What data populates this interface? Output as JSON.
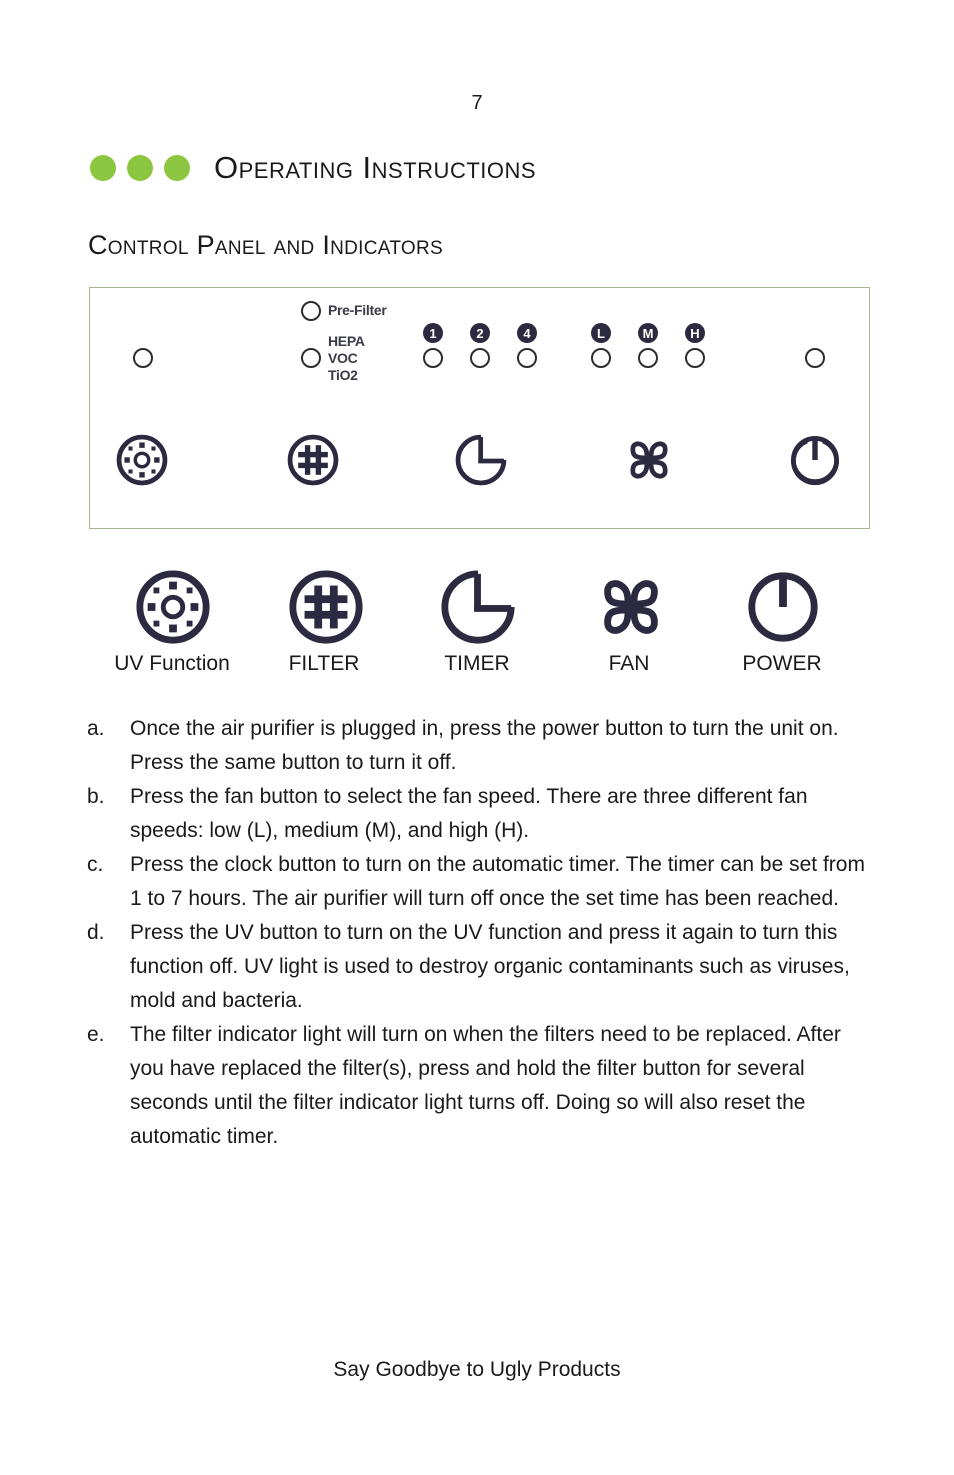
{
  "page_number": "7",
  "heading": "Operating Instructions",
  "subheading": "Control Panel and Indicators",
  "colors": {
    "accent_green": "#8cc540",
    "panel_border": "#a3b58d",
    "icon_dark": "#2c2a40"
  },
  "panel": {
    "filter_labels": {
      "pre_filter": "Pre-Filter",
      "hepa": "HEPA",
      "voc": "VOC",
      "tio2": "TiO2"
    },
    "timer_badges": [
      "1",
      "2",
      "4"
    ],
    "fan_badges": [
      "L",
      "M",
      "H"
    ],
    "icons": [
      "uv-icon",
      "filter-icon",
      "timer-icon",
      "fan-icon",
      "power-icon"
    ]
  },
  "buttons": [
    {
      "icon": "uv-icon",
      "label": "UV Function"
    },
    {
      "icon": "filter-icon",
      "label": "FILTER"
    },
    {
      "icon": "timer-icon",
      "label": "TIMER"
    },
    {
      "icon": "fan-icon",
      "label": "FAN"
    },
    {
      "icon": "power-icon",
      "label": "POWER"
    }
  ],
  "instructions": [
    {
      "marker": "a.",
      "text": "Once the air purifier is plugged in, press the power button to turn the unit on. Press the same button to turn it off."
    },
    {
      "marker": "b.",
      "text": "Press the fan button to select the fan speed. There are three different fan speeds: low (L), medium (M), and high (H)."
    },
    {
      "marker": "c.",
      "text": "Press the clock button to turn on the automatic timer. The timer can be set from 1 to 7 hours. The air purifier will turn off once the set time has been reached."
    },
    {
      "marker": "d.",
      "text": "Press the UV button to turn on the UV function and press it again to turn this function off. UV light is used to destroy organic contaminants such as viruses, mold and bacteria."
    },
    {
      "marker": "e.",
      "text": "The filter indicator light will turn on when the filters need to be replaced. After you have replaced the filter(s), press and hold the filter button for several seconds until the filter indicator light turns off. Doing so will also reset the automatic timer."
    }
  ],
  "footer": "Say Goodbye to Ugly Products"
}
